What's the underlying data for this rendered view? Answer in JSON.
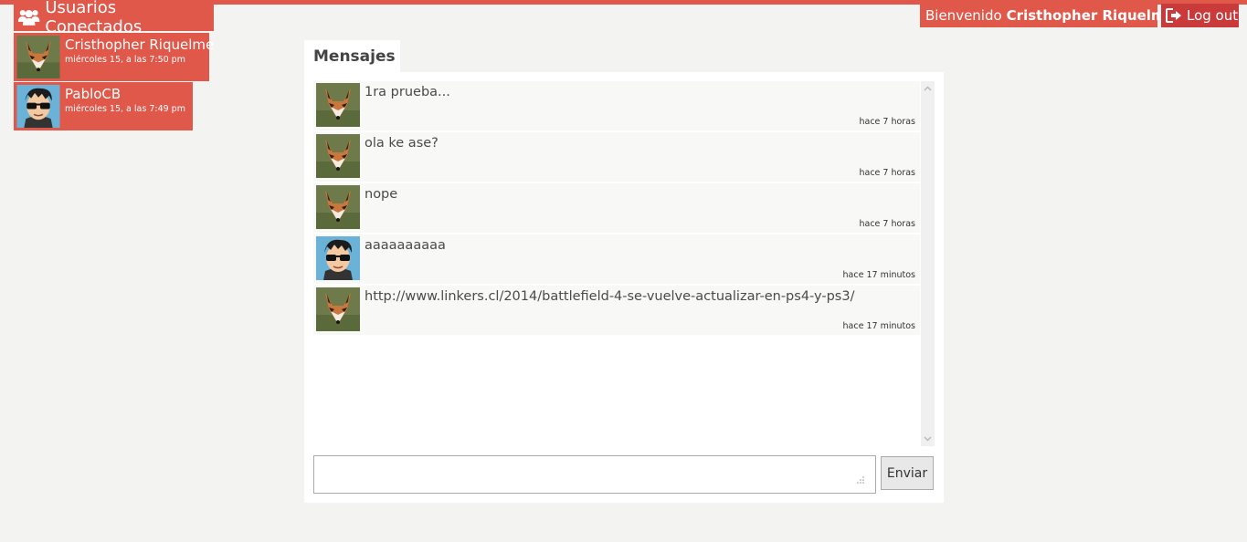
{
  "sidebar": {
    "title": "Usuarios Conectados",
    "users": [
      {
        "name": "Cristhopher Riquelme",
        "time": "miércoles 15, a las 7:50 pm",
        "avatar": "fox-avatar"
      },
      {
        "name": "PabloCB",
        "time": "miércoles 15, a las 7:49 pm",
        "avatar": "cartoon-sunglasses-avatar"
      }
    ]
  },
  "header": {
    "welcome_prefix": "Bienvenido",
    "welcome_name": "Cristhopher Riquelme",
    "logout_label": "Log out"
  },
  "messages_tab": "Mensajes",
  "messages": [
    {
      "text": "1ra prueba...",
      "ago": "hace 7 horas",
      "avatar": "fox-avatar"
    },
    {
      "text": "ola ke ase?",
      "ago": "hace 7 horas",
      "avatar": "fox-avatar"
    },
    {
      "text": "nope",
      "ago": "hace 7 horas",
      "avatar": "fox-avatar"
    },
    {
      "text": "aaaaaaaaaa",
      "ago": "hace 17 minutos",
      "avatar": "cartoon-sunglasses-avatar"
    },
    {
      "text": "http://www.linkers.cl/2014/battlefield-4-se-vuelve-actualizar-en-ps4-y-ps3/",
      "ago": "hace 17 minutos",
      "avatar": "fox-avatar"
    }
  ],
  "composer": {
    "value": "",
    "send_label": "Enviar"
  },
  "colors": {
    "accent": "#e0584a",
    "logout": "#c93b3b",
    "background": "#f3f3f2"
  }
}
